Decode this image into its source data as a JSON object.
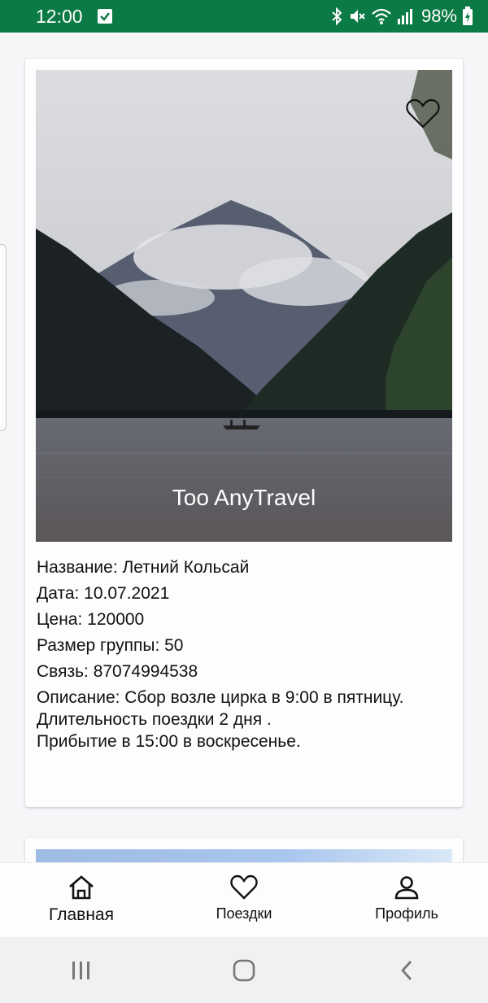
{
  "status_bar": {
    "time": "12:00",
    "battery": "98%",
    "icons": [
      "check-notification-icon",
      "bluetooth-icon",
      "mute-icon",
      "wifi-icon",
      "signal-icon",
      "battery-charging-icon"
    ]
  },
  "card": {
    "company_name": "Too AnyTravel",
    "favorite_icon": "heart-outline-icon",
    "details": {
      "name": "Название: Летний Кольсай",
      "date": "Дата: 10.07.2021",
      "price": "Цена: 120000",
      "group_size": "Размер группы: 50",
      "contact": "Связь: 87074994538",
      "description": "Описание: Сбор возле цирка в 9:00 в пятницу.\nДлительность поездки 2 дня .\nПрибытие в 15:00 в воскресенье."
    }
  },
  "bottom_nav": {
    "items": [
      {
        "label": "Главная",
        "icon": "home-icon",
        "active": true
      },
      {
        "label": "Поездки",
        "icon": "heart-icon",
        "active": false
      },
      {
        "label": "Профиль",
        "icon": "profile-icon",
        "active": false
      }
    ]
  },
  "system_nav": {
    "icons": [
      "recent-apps-icon",
      "home-circle-icon",
      "back-icon"
    ]
  },
  "colors": {
    "status_bar": "#0b7a44",
    "background": "#f6f5f8",
    "text": "#111111"
  }
}
